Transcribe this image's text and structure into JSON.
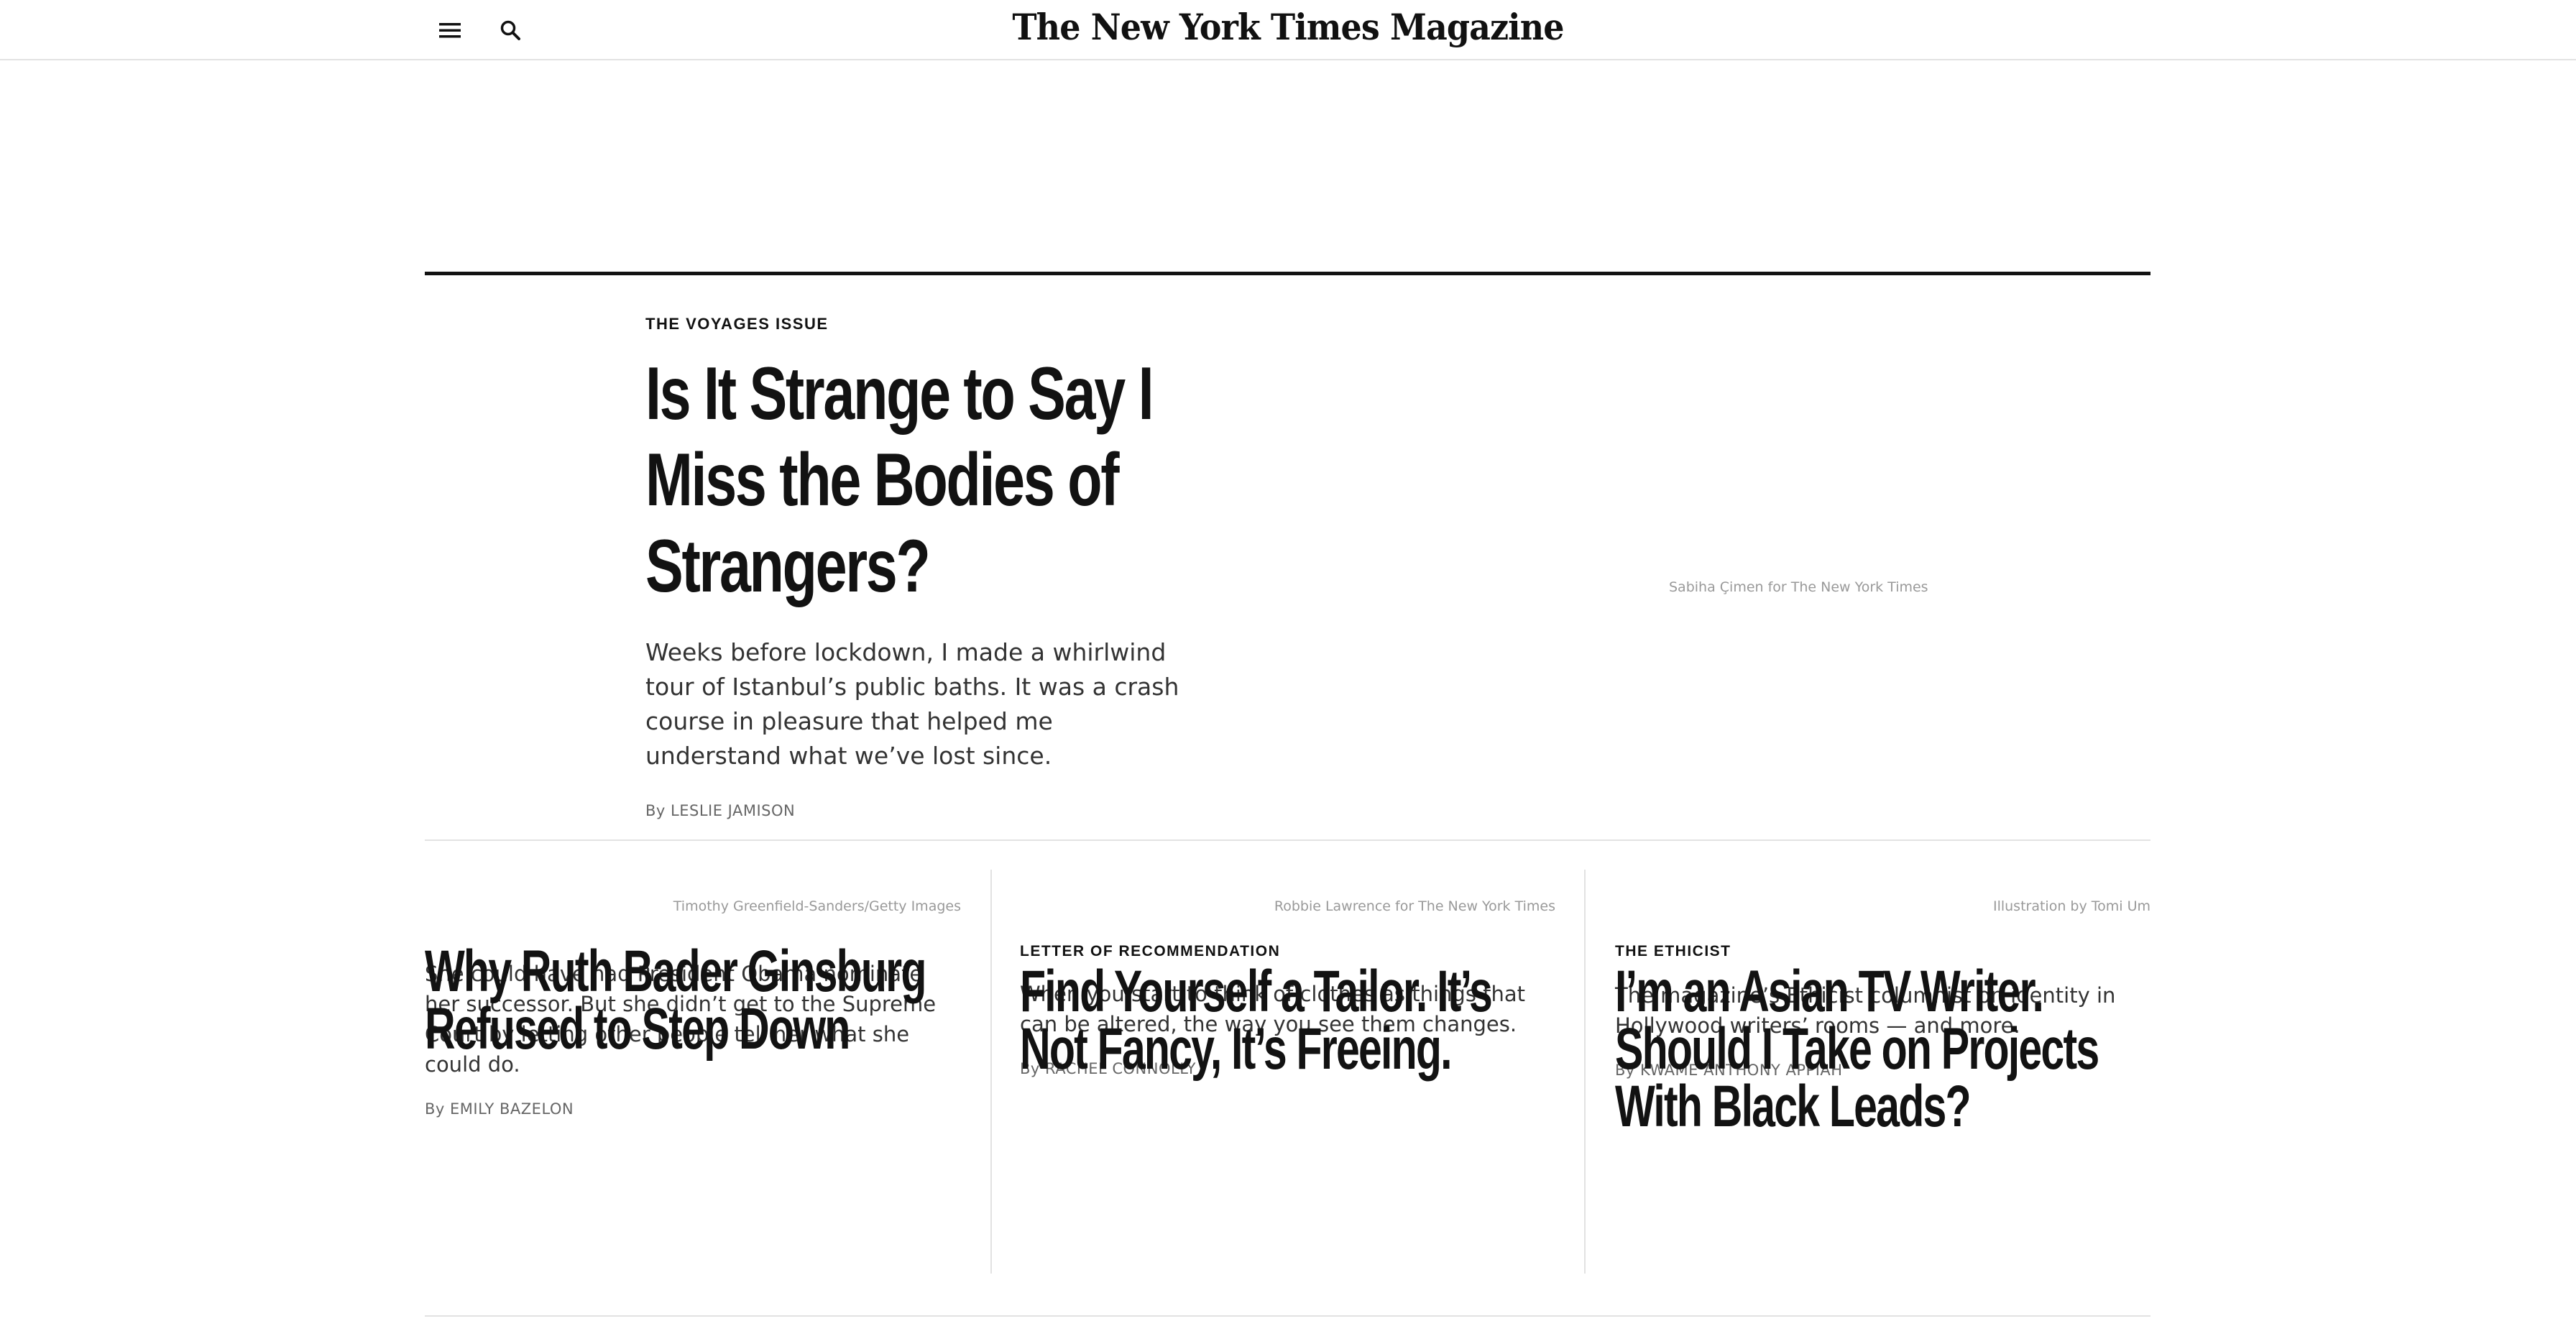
{
  "masthead": {
    "menu_icon": "hamburger-menu-icon",
    "search_icon": "search-icon",
    "brand": "The New York Times Magazine"
  },
  "lead": {
    "kicker": "THE VOYAGES ISSUE",
    "headline": "Is It Strange to Say I Miss the Bodies of Strangers?",
    "summary": "Weeks before lockdown, I made a whirlwind tour of Istanbul’s public baths. It was a crash course in pleasure that helped me understand what we’ve lost since.",
    "by": "By",
    "author": "LESLIE JAMISON",
    "image_credit": "Sabiha Çimen for The New York Times"
  },
  "stories": [
    {
      "image_credit": "Timothy Greenfield-Sanders/Getty Images",
      "kicker": "",
      "headline": "Why Ruth Bader Ginsburg Refused to Step Down",
      "summary": "She could have had President Obama nominate her successor. But she didn’t get to the Supreme Court by letting other people tell her what she could do.",
      "by": "By",
      "author": "EMILY BAZELON"
    },
    {
      "image_credit": "Robbie Lawrence for The New York Times",
      "kicker": "LETTER OF RECOMMENDATION",
      "headline": "Find Yourself a Tailor. It’s Not Fancy, It’s Freeing.",
      "summary": "When you start to think of clothes as things that can be altered, the way you see them changes.",
      "by": "By",
      "author": "RACHEL CONNOLLY"
    },
    {
      "image_credit": "Illustration by Tomi Um",
      "kicker": "THE ETHICIST",
      "headline": "I’m an Asian TV Writer. Should I Take on Projects With Black Leads?",
      "summary": "The magazine’s Ethicist columnist on identity in Hollywood writers’ rooms — and more.",
      "by": "By",
      "author": "KWAME ANTHONY APPIAH"
    }
  ]
}
